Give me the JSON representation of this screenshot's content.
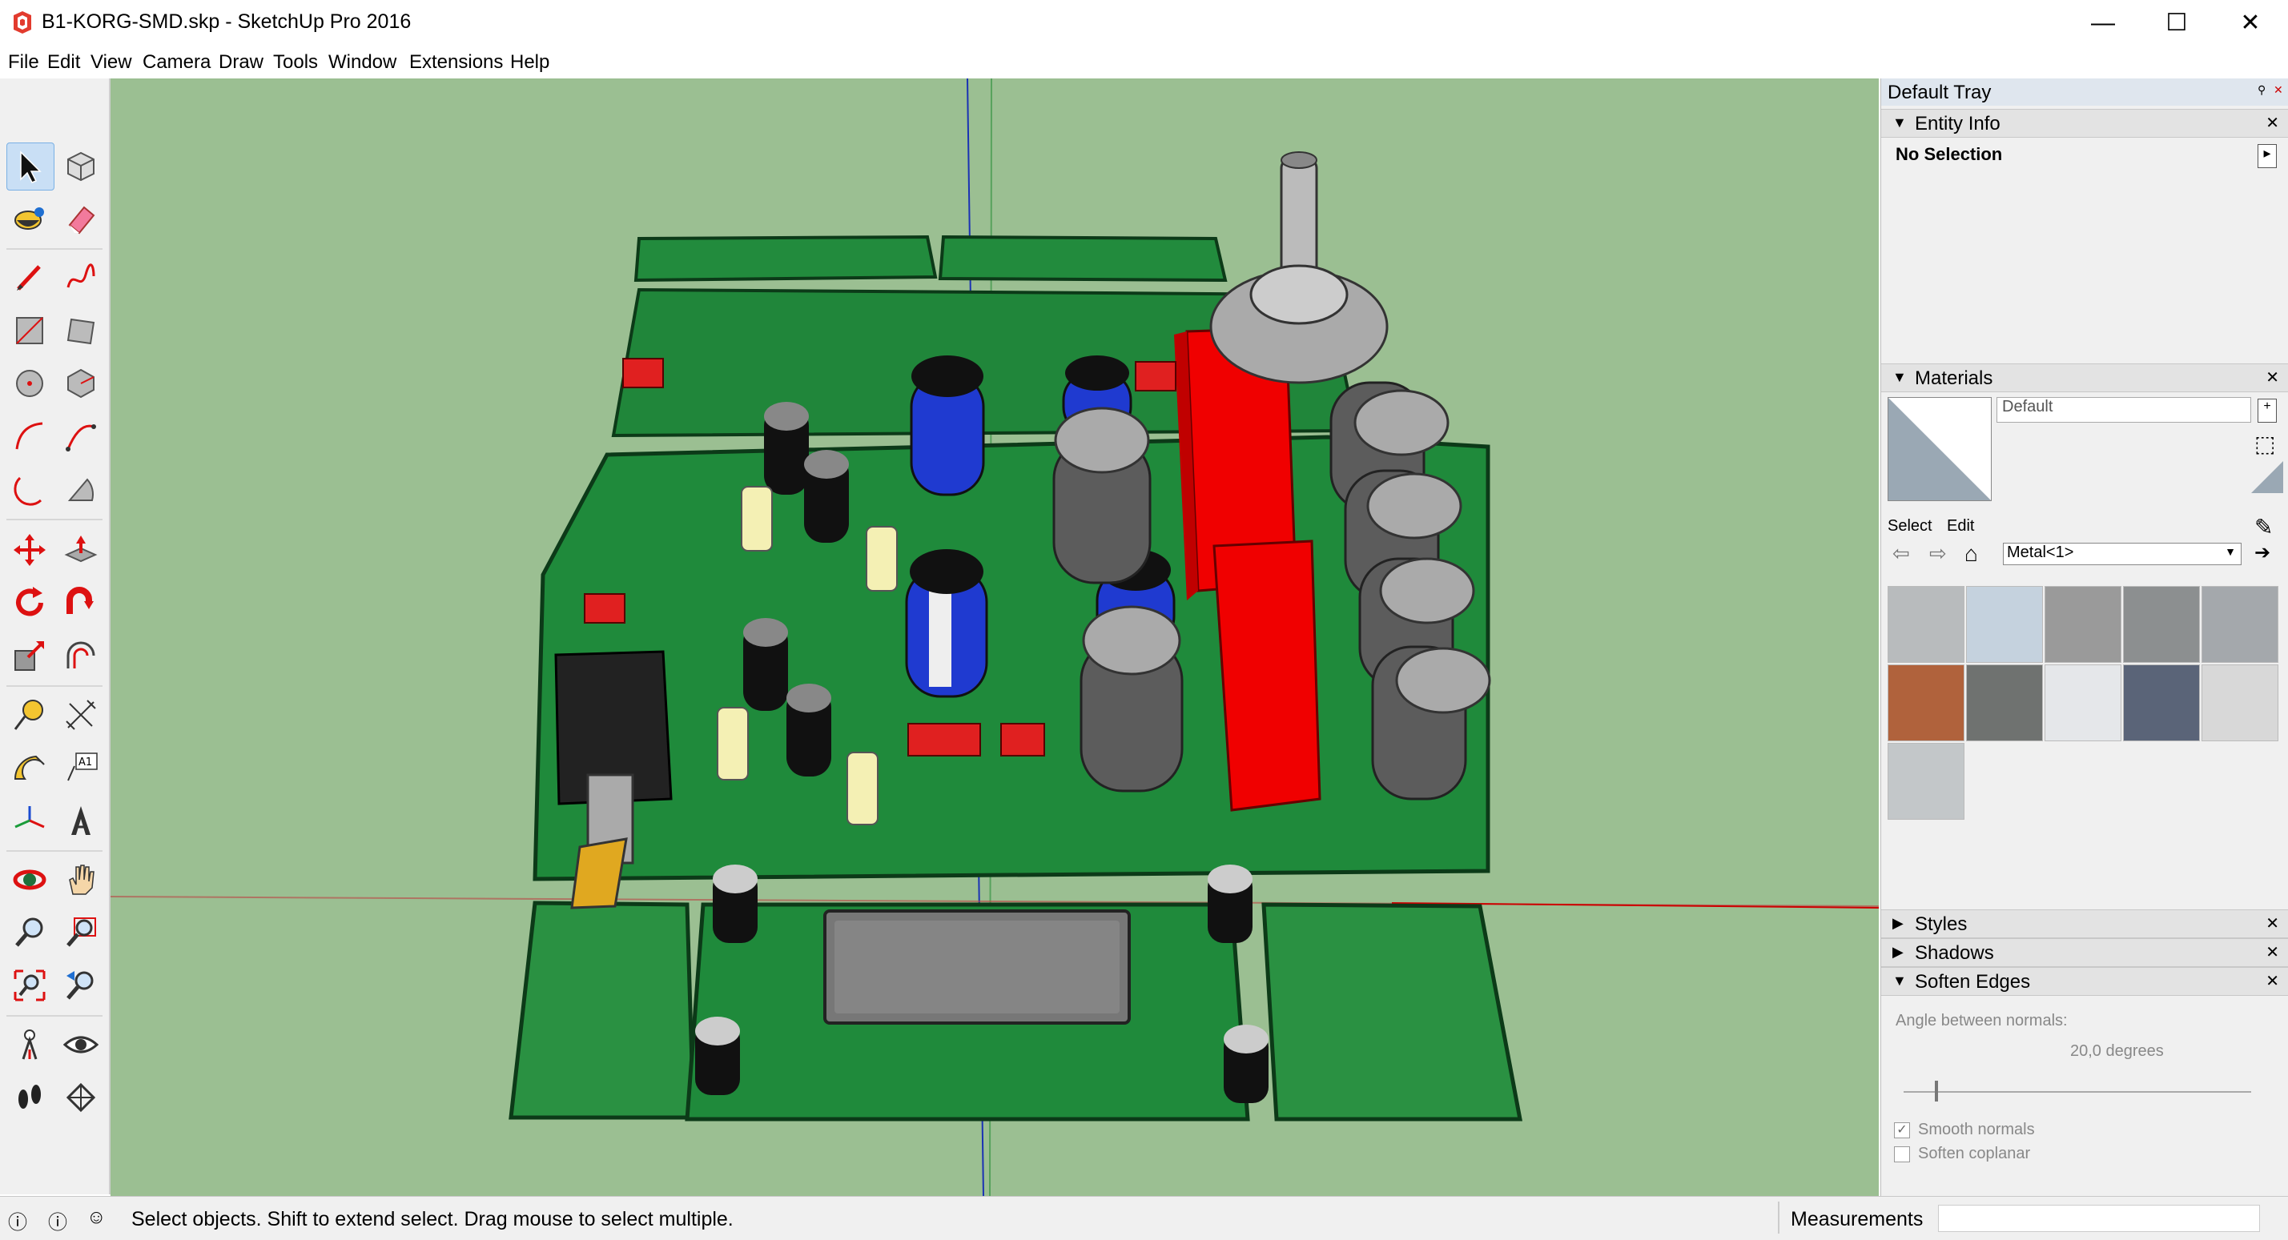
{
  "window": {
    "title": "B1-KORG-SMD.skp - SketchUp Pro 2016",
    "controls": {
      "minimize": "—",
      "maximize": "☐",
      "close": "✕"
    }
  },
  "menu": [
    "File",
    "Edit",
    "View",
    "Camera",
    "Draw",
    "Tools",
    "Window",
    "Extensions",
    "Help"
  ],
  "toolbar": {
    "tools": [
      "select-tool",
      "component-tool",
      "paint-bucket-tool",
      "eraser-tool",
      "line-tool",
      "freehand-tool",
      "rectangle-tool",
      "rotated-rectangle-tool",
      "circle-tool",
      "polygon-tool",
      "arc-tool",
      "two-point-arc-tool",
      "three-point-arc-tool",
      "pie-tool",
      "move-tool",
      "push-pull-tool",
      "rotate-tool",
      "follow-me-tool",
      "scale-tool",
      "offset-tool",
      "tape-measure-tool",
      "dimension-tool",
      "protractor-tool",
      "text-tool",
      "axes-tool",
      "3d-text-tool",
      "orbit-tool",
      "pan-tool",
      "zoom-tool",
      "zoom-window-tool",
      "zoom-extents-tool",
      "previous-view-tool",
      "position-camera-tool",
      "look-around-tool",
      "walk-tool",
      "section-plane-tool"
    ],
    "text_tool_label": "A1"
  },
  "tray": {
    "title": "Default Tray",
    "entity_info": {
      "header": "Entity Info",
      "selection": "No Selection"
    },
    "materials": {
      "header": "Materials",
      "current_name": "Default",
      "tab_select": "Select",
      "tab_edit": "Edit",
      "library": "Metal<1>",
      "swatches": [
        {
          "name": "metal-swatch-1",
          "color": "#b8bbbd"
        },
        {
          "name": "metal-swatch-2",
          "color": "#c5d2de"
        },
        {
          "name": "metal-swatch-3",
          "color": "#9a9a9a"
        },
        {
          "name": "metal-swatch-4",
          "color": "#8c8f90"
        },
        {
          "name": "metal-swatch-5",
          "color": "#a4a8ac"
        },
        {
          "name": "metal-swatch-6",
          "color": "#b0623c"
        },
        {
          "name": "metal-swatch-7",
          "color": "#6f7270"
        },
        {
          "name": "metal-swatch-8",
          "color": "#e5e7ea"
        },
        {
          "name": "metal-swatch-9",
          "color": "#5a6478"
        },
        {
          "name": "metal-swatch-10",
          "color": "#d8d8d8"
        },
        {
          "name": "metal-swatch-11",
          "color": "#c3c7c9"
        }
      ]
    },
    "styles": {
      "header": "Styles"
    },
    "shadows": {
      "header": "Shadows"
    },
    "soften_edges": {
      "header": "Soften Edges",
      "angle_label": "Angle between normals:",
      "angle_value": "20,0  degrees",
      "slider_fraction": 0.09,
      "smooth_normals": "Smooth normals",
      "soften_coplanar": "Soften coplanar"
    }
  },
  "status": {
    "message": "Select objects. Shift to extend select. Drag mouse to select multiple.",
    "measurements_label": "Measurements"
  },
  "colors": {
    "viewport_bg": "#9bbf92",
    "pcb_green": "#1e8a3c",
    "relay_red": "#f00000",
    "capacitor_blue": "#1f3ad0"
  }
}
